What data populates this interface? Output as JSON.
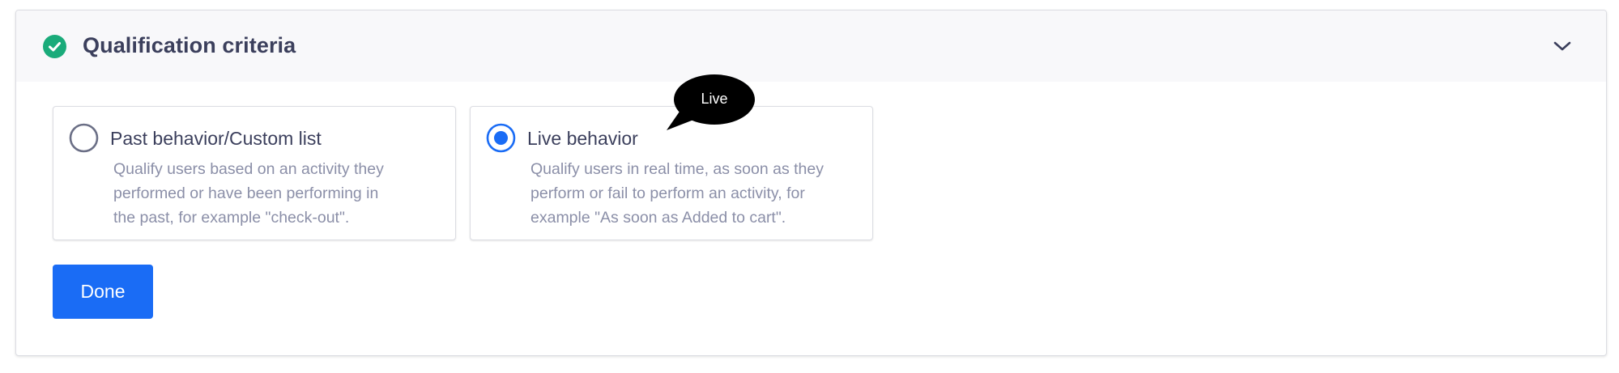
{
  "panel": {
    "title": "Qualification criteria",
    "status_icon": "check-circle-icon",
    "collapse_icon": "chevron-down-icon"
  },
  "options": [
    {
      "label": "Past behavior/Custom list",
      "selected": false,
      "description_lines": [
        "Qualify users based on an activity they",
        "performed or have been performing in",
        "the past, for example \"check-out\"."
      ]
    },
    {
      "label": "Live behavior",
      "selected": true,
      "description_lines": [
        "Qualify users in real time, as soon as they",
        "perform or fail to perform an activity, for",
        "example \"As soon as Added to cart\"."
      ]
    }
  ],
  "done_button": {
    "label": "Done"
  },
  "tooltip": {
    "text": "Live"
  },
  "colors": {
    "accent": "#1a6cf5",
    "success": "#1aab7a",
    "title_text": "#3b3f5c",
    "muted_text": "#8b8fa8",
    "tooltip_bg": "#000000"
  }
}
